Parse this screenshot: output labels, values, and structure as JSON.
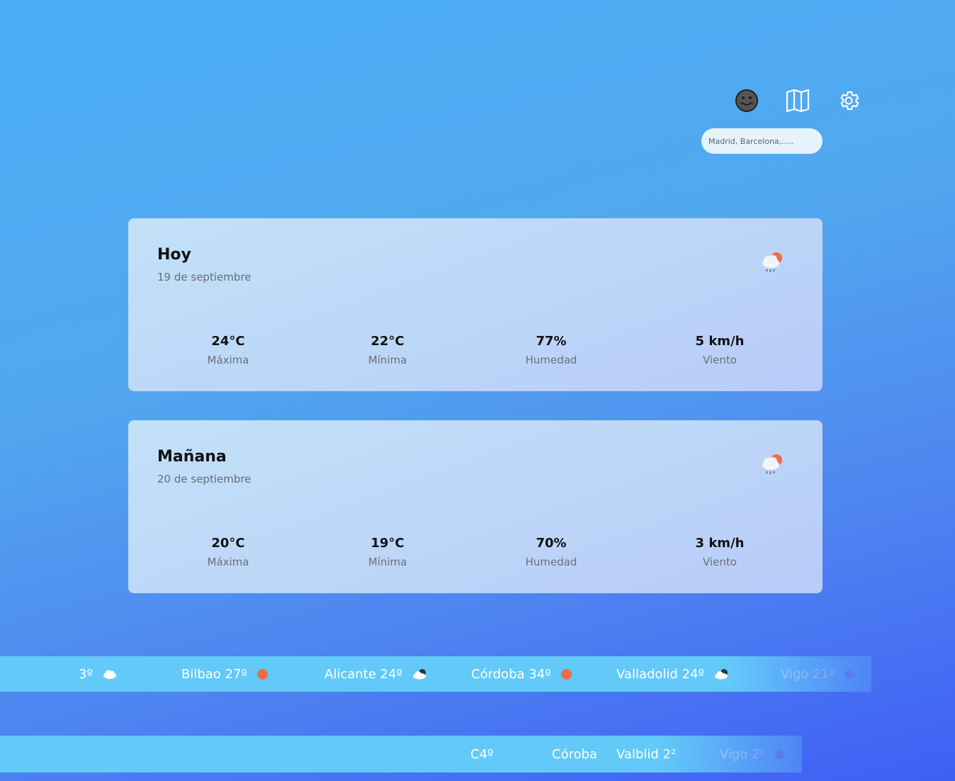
{
  "header": {
    "icons": [
      "dark-mode-icon",
      "map-icon",
      "settings-icon"
    ],
    "search_placeholder": "Madrid, Barcelona,....."
  },
  "forecast": {
    "today": {
      "title": "Hoy",
      "date": "19 de septiembre",
      "icon": "rain-sun-icon",
      "max": "24°C",
      "max_label": "Máxima",
      "min": "22°C",
      "min_label": "Mínima",
      "humidity": "77%",
      "humidity_label": "Humedad",
      "wind": "5 km/h",
      "wind_label": "Viento"
    },
    "tomorrow": {
      "title": "Mañana",
      "date": "20 de septiembre",
      "icon": "rain-sun-icon",
      "max": "20°C",
      "max_label": "Máxima",
      "min": "19°C",
      "min_label": "Mínima",
      "humidity": "70%",
      "humidity_label": "Humedad",
      "wind": "3 km/h",
      "wind_label": "Viento"
    }
  },
  "ticker_one": [
    {
      "text": "3º",
      "icon": "cloud-icon"
    },
    {
      "text": "Bilbao 27º",
      "icon": "sun-dot-icon"
    },
    {
      "text": "Alicante 24º",
      "icon": "cloud-moon-icon"
    },
    {
      "text": "Córdoba 34º",
      "icon": "sun-dot-icon"
    },
    {
      "text": "Valladolid 24º",
      "icon": "cloud-moon-icon"
    },
    {
      "text": "Vigo 21º",
      "icon": "dot-icon"
    }
  ],
  "ticker_two": [
    {
      "text": "C4º"
    },
    {
      "text": "Córoba"
    },
    {
      "text": "Valblid 2²"
    },
    {
      "text": "Vigo 2¹",
      "icon": "dot-icon"
    }
  ],
  "colors": {
    "accent_red": "#f06a4d",
    "ticker_bg": "#63c9f8",
    "card_bg": "#c2e1f8"
  }
}
